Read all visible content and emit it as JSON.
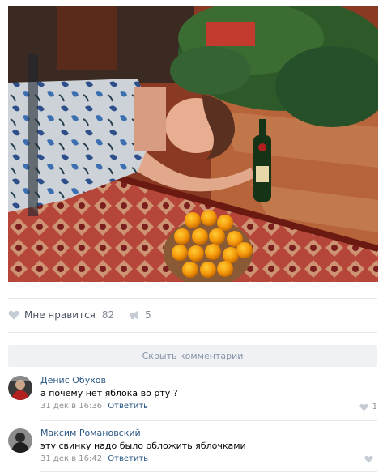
{
  "post": {
    "likes_label": "Мне нравится",
    "likes_count": "82",
    "reposts_count": "5"
  },
  "comments_bar": {
    "hide_label": "Скрыть комментарии"
  },
  "comments": [
    {
      "author": "Денис Обухов",
      "text": "а почему нет яблока во рту ?",
      "date": "31 дек в 16:36",
      "reply_label": "Ответить",
      "likes": "1"
    },
    {
      "author": "Максим Романовский",
      "text": "эту свинку надо было обложить яблочками",
      "date": "31 дек в 16:42",
      "reply_label": "Ответить",
      "likes": ""
    }
  ],
  "colors": {
    "link": "#2a5885",
    "muted": "#828a99",
    "bar_bg": "#eff1f4"
  }
}
